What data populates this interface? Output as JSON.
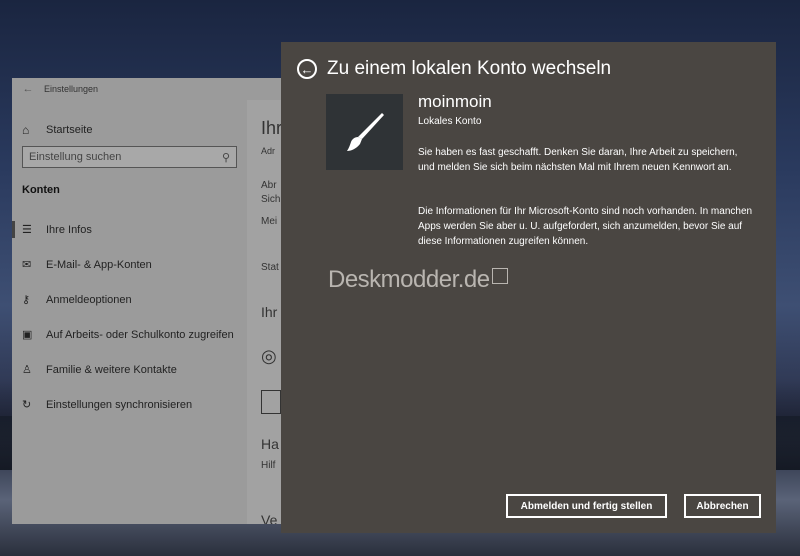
{
  "settings": {
    "window_title": "Einstellungen",
    "home_label": "Startseite",
    "search_placeholder": "Einstellung suchen",
    "section_label": "Konten",
    "nav_items": [
      {
        "label": "Ihre Infos",
        "icon": "person-card-icon"
      },
      {
        "label": "E-Mail- & App-Konten",
        "icon": "mail-icon"
      },
      {
        "label": "Anmeldeoptionen",
        "icon": "key-icon"
      },
      {
        "label": "Auf Arbeits- oder Schulkonto zugreifen",
        "icon": "briefcase-icon"
      },
      {
        "label": "Familie & weitere Kontakte",
        "icon": "person-add-icon"
      },
      {
        "label": "Einstellungen synchronisieren",
        "icon": "sync-icon"
      }
    ],
    "right_fragments": [
      "Ihr",
      "Adr",
      "Abr",
      "Sich",
      "Mei",
      "Stat",
      "Ihr",
      "Ha",
      "Hilf",
      "Ve"
    ]
  },
  "dialog": {
    "title": "Zu einem lokalen Konto wechseln",
    "account_name": "moinmoin",
    "account_type": "Lokales Konto",
    "paragraph1": "Sie haben es fast geschafft. Denken Sie daran, Ihre Arbeit zu speichern, und melden Sie sich beim nächsten Mal mit Ihrem neuen Kennwort an.",
    "paragraph2": "Die Informationen für Ihr Microsoft-Konto sind noch vorhanden. In manchen Apps werden Sie aber u. U. aufgefordert, sich anzumelden, bevor Sie auf diese Informationen zugreifen können.",
    "watermark": "Deskmodder.de",
    "primary_button": "Abmelden und fertig stellen",
    "cancel_button": "Abbrechen"
  }
}
